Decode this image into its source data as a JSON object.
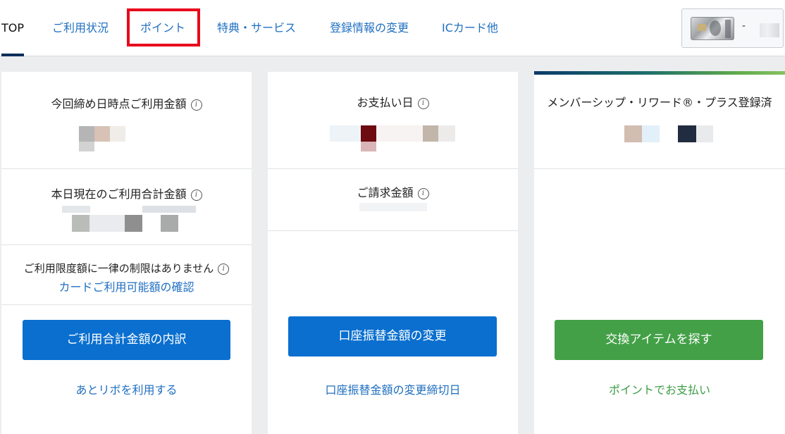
{
  "nav": {
    "tabs": [
      {
        "label": "TOP"
      },
      {
        "label": "ご利用状況"
      },
      {
        "label": "ポイント"
      },
      {
        "label": "特典・サービス"
      },
      {
        "label": "登録情報の変更"
      },
      {
        "label": "ICカード他"
      }
    ],
    "active_tab": "TOP",
    "highlighted_tab": "ポイント",
    "card_selector_dash": "-"
  },
  "usage_column": {
    "closing_amount_label": "今回締め日時点ご利用金額",
    "today_total_label": "本日現在のご利用合計金額",
    "limit_notice": "ご利用限度額に一律の制限はありません",
    "check_available_link": "カードご利用可能額の確認",
    "breakdown_button": "ご利用合計金額の内訳",
    "revolving_link": "あとリボを利用する"
  },
  "payment_column": {
    "payment_date_label": "お支払い日",
    "billing_amount_label": "ご請求金額",
    "change_amount_button": "口座振替金額の変更",
    "change_deadline_link": "口座振替金額の変更締切日"
  },
  "rewards_column": {
    "status_label": "メンバーシップ・リワード®・プラス登録済",
    "exchange_button": "交換アイテムを探す",
    "pay_with_points_link": "ポイントでお支払い"
  },
  "colors": {
    "primary_blue": "#0a6fcf",
    "link_blue": "#1f6fc0",
    "green_button": "#43a047",
    "highlight_red": "#e8081d"
  },
  "icons": {
    "info": "info-icon"
  }
}
